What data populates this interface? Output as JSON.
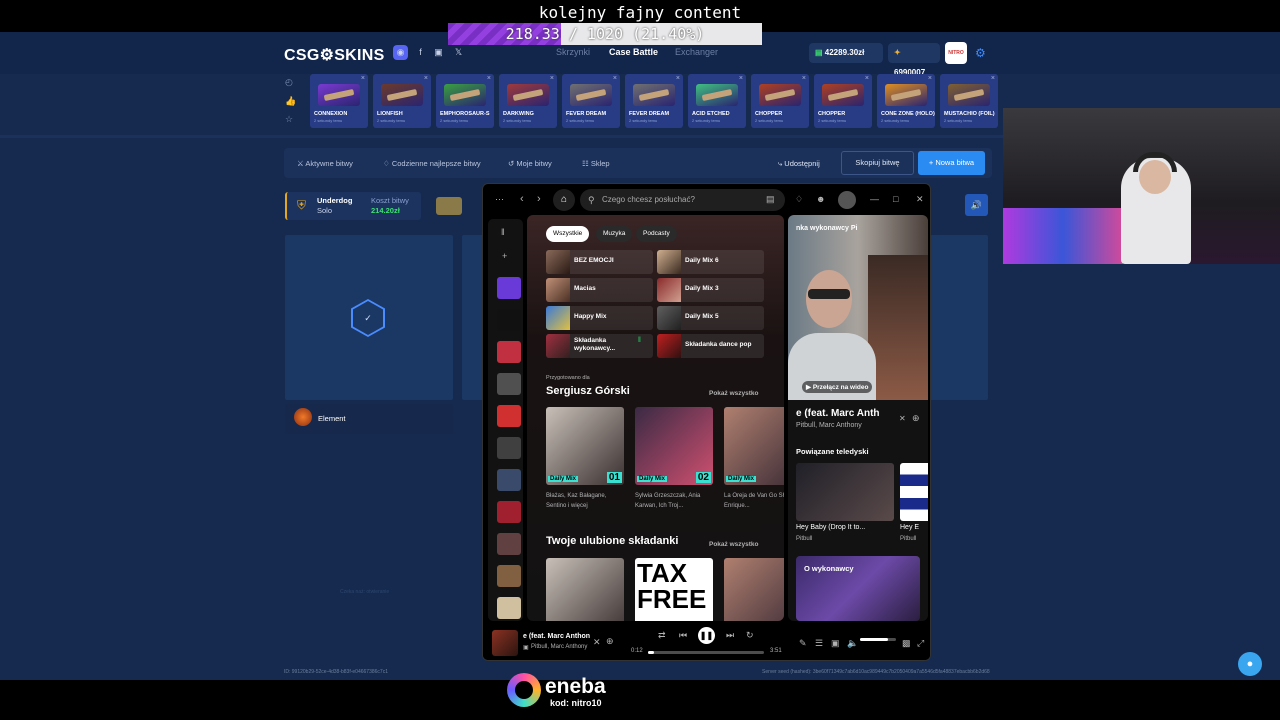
{
  "overlay": {
    "title": "kolejny fajny content",
    "goal_text": "218.33 / 1020 (21.40%)",
    "goal_progress": 0.214
  },
  "site": {
    "logo": "CSG⚙SKINS",
    "nav": [
      "Skrzynki",
      "Case Battle",
      "Exchanger"
    ],
    "balance": "42289.30zł",
    "points": "6990007",
    "avatar_text": "NITRO",
    "cases": [
      {
        "name": "CONNEXION",
        "sub": "2 sekundy temu",
        "color": "#7a3ad0"
      },
      {
        "name": "LIONFISH",
        "sub": "2 sekundy temu",
        "color": "#6c3a2a"
      },
      {
        "name": "EMPHOROSAUR-S",
        "sub": "2 sekundy temu",
        "color": "#3aa040"
      },
      {
        "name": "DARKWING",
        "sub": "2 sekundy temu",
        "color": "#a03a3a"
      },
      {
        "name": "FEVER DREAM",
        "sub": "2 sekundy temu",
        "color": "#707070"
      },
      {
        "name": "FEVER DREAM",
        "sub": "2 sekundy temu",
        "color": "#707070"
      },
      {
        "name": "ACID ETCHED",
        "sub": "2 sekundy temu",
        "color": "#40c080"
      },
      {
        "name": "CHOPPER",
        "sub": "2 sekundy temu",
        "color": "#b04020"
      },
      {
        "name": "CHOPPER",
        "sub": "2 sekundy temu",
        "color": "#b04020"
      },
      {
        "name": "CONE ZONE (HOLO)",
        "sub": "2 sekundy temu",
        "color": "#e09020"
      },
      {
        "name": "MUSTACHIO (FOIL)",
        "sub": "2 sekundy temu",
        "color": "#806030"
      }
    ],
    "subnav": [
      "Aktywne bitwy",
      "Codzienne najlepsze bitwy",
      "Moje bitwy",
      "Sklep"
    ],
    "share": "Udostępnij",
    "copy": "Skopiuj bitwę",
    "new_battle": "+ Nowa bitwa",
    "battle_mode": "Underdog",
    "battle_type": "Solo",
    "cost_label": "Koszt bitwy",
    "cost": "214.20zł",
    "element": "Element",
    "faint": "Czeka naż: otwieranie",
    "footer_id": "ID: 99120b29-52ce-4d38-b83f-e04667386c7c1",
    "footer_seed": "Server seed (hashed): 3be60f71349c7ab6d10ac989449c7b2050409a7a5546d5fa48837ebacbb6b2d68"
  },
  "spotify": {
    "search_placeholder": "Czego chcesz posłuchać?",
    "chips": [
      "Wszystkie",
      "Muzyka",
      "Podcasty"
    ],
    "tiles": [
      {
        "title": "BEZ EMOCJI",
        "c1": "#8a6a5a",
        "c2": "#2a1a14"
      },
      {
        "title": "Daily Mix 6",
        "c1": "#d0b090",
        "c2": "#3a2a20"
      },
      {
        "title": "Macias",
        "c1": "#c09078",
        "c2": "#4a3024"
      },
      {
        "title": "Daily Mix 3",
        "c1": "#8a2a2a",
        "c2": "#d0a090"
      },
      {
        "title": "Happy Mix",
        "c1": "#3a7ad8",
        "c2": "#e0c040"
      },
      {
        "title": "Daily Mix 5",
        "c1": "#606060",
        "c2": "#202020"
      },
      {
        "title": "Składanka wykonawcy...",
        "c1": "#a03040",
        "c2": "#302020"
      },
      {
        "title": "Składanka dance pop",
        "c1": "#c02020",
        "c2": "#301010"
      }
    ],
    "made_for": "Przygotowano dla",
    "user": "Sergiusz Górski",
    "show_all": "Pokaż wszystko",
    "mixes": [
      {
        "label": "Daily Mix",
        "num": "01",
        "desc": "Błażas, Kaz Bałagane, Sentino i więcej"
      },
      {
        "label": "Daily Mix",
        "num": "02",
        "desc": "Sylwia Grzeszczak, Ania Karwan, Ich Troj..."
      },
      {
        "label": "Daily Mix",
        "num": "",
        "desc": "La Oreja de Van Go Shakira, Enrique..."
      }
    ],
    "favorites": "Twoje ulubione składanki",
    "tax_free": "TAX FREE",
    "right_title": "nka wykonawcy Pi",
    "switch_video": "Przełącz na wideo",
    "now_song": "e (feat. Marc Anth",
    "now_artist": "Pitbull, Marc Anthony",
    "related": "Powiązane teledyski",
    "videos": [
      {
        "title": "Hey Baby (Drop It to...",
        "artist": "Pitbull"
      },
      {
        "title": "Hey E",
        "artist": "Pitbull"
      }
    ],
    "about": "O wykonawcy",
    "player_title": "e (feat. Marc Anthon",
    "player_artist": "Pitbull, Marc Anthony",
    "elapsed": "0:12",
    "duration": "3:51",
    "progress": 0.052,
    "lib_colors": [
      "#6a3ad8",
      "#111",
      "#c03040",
      "#505050",
      "#d03030",
      "#404040",
      "#3a4a6a",
      "#a02030",
      "#604040",
      "#806040",
      "#d0c0a0"
    ]
  },
  "eneba": {
    "name": "eneba",
    "code": "kod: nitro10"
  }
}
